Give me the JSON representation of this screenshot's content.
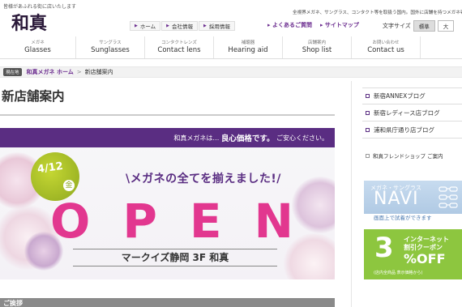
{
  "header": {
    "tagline": "皆様があふれる街に店いたします",
    "description": "全視界メガネ、サングラス、コンタクト等を取扱う国内。国外に店舗を持つメガネ専門店",
    "logo_text": "和真",
    "top_links": [
      {
        "label": "ホーム"
      },
      {
        "label": "会社情報"
      },
      {
        "label": "採用情報"
      }
    ],
    "faq_label": "よくあるご質問",
    "sitemap_label": "サイトマップ",
    "font_size_label": "文字サイズ",
    "font_size_standard": "標準",
    "font_size_large": "大"
  },
  "gnav": [
    {
      "jp": "メガネ",
      "en": "Glasses"
    },
    {
      "jp": "サングラス",
      "en": "Sunglasses"
    },
    {
      "jp": "コンタクトレンズ",
      "en": "Contact lens"
    },
    {
      "jp": "補聴器",
      "en": "Hearing aid"
    },
    {
      "jp": "店舗案内",
      "en": "Shop list"
    },
    {
      "jp": "お問い合わせ",
      "en": "Contact us"
    }
  ],
  "breadcrumb": {
    "here": "現在地",
    "home": "和真メガネ ホーム",
    "sep": ">",
    "current": "新店舗案内"
  },
  "page_title": "新店舗案内",
  "banner": {
    "top_lead": "和真メガネは…",
    "top_bold": "良心価格です。",
    "top_tail": "ご安心ください。",
    "date": "4/12",
    "date_day": "金",
    "catch": "\\メガネの全てを揃えました!/",
    "open_letters": [
      "O",
      "P",
      "E",
      "N"
    ],
    "store": "マークイズ静岡 3F 和真"
  },
  "section_heading": "ご挨拶",
  "sidebar": {
    "items": [
      {
        "label": "新宿ANNEXブログ"
      },
      {
        "label": "新宿レディース店ブログ"
      },
      {
        "label": "浦和県庁通り店ブログ"
      }
    ],
    "friend": "和真フレンドショップ ご案内",
    "navi_sub": "メガネ・サングラス",
    "navi_big": "NAVI",
    "navi_cap": "画面上で試着ができます",
    "coupon_num": "3",
    "coupon_l1": "インターネット",
    "coupon_l2": "割引クーポン",
    "coupon_off": "%OFF",
    "coupon_note": "(店内全商品 表示価格から)"
  }
}
